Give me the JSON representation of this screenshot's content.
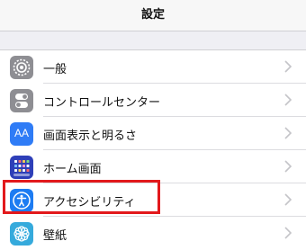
{
  "navbar": {
    "title": "設定"
  },
  "rows": [
    {
      "label": "一般",
      "icon": "gear-icon",
      "color": "#8e8e93"
    },
    {
      "label": "コントロールセンター",
      "icon": "toggles-icon",
      "color": "#8e8e93"
    },
    {
      "label": "画面表示と明るさ",
      "icon": "text-size-icon",
      "color": "#2f7cf6",
      "icon_text": "AA"
    },
    {
      "label": "ホーム画面",
      "icon": "home-screen-grid-icon",
      "color": "#2e3fb8"
    },
    {
      "label": "アクセシビリティ",
      "icon": "accessibility-icon",
      "color": "#1d7cf2"
    },
    {
      "label": "壁紙",
      "icon": "wallpaper-flower-icon",
      "color": "#35aadc"
    }
  ],
  "highlight_color": "#e2191c"
}
